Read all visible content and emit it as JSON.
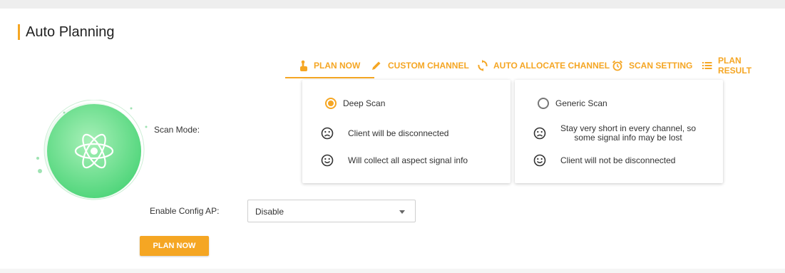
{
  "page": {
    "title": "Auto Planning",
    "accent_color": "#f5a623"
  },
  "tabs": [
    {
      "label": "PLAN NOW",
      "icon": "hand-pointer-icon",
      "active": true
    },
    {
      "label": "CUSTOM CHANNEL",
      "icon": "pencil-icon",
      "active": false
    },
    {
      "label": "AUTO ALLOCATE CHANNEL",
      "icon": "sync-icon",
      "active": false
    },
    {
      "label": "SCAN SETTING",
      "icon": "alarm-clock-icon",
      "active": false
    },
    {
      "label": "PLAN RESULT",
      "icon": "list-icon",
      "active": false
    }
  ],
  "scan_mode": {
    "label": "Scan Mode:",
    "options": [
      {
        "label": "Deep Scan",
        "selected": true,
        "items": [
          {
            "icon": "sad-face-icon",
            "text": "Client will be disconnected"
          },
          {
            "icon": "happy-face-icon",
            "text": "Will collect all aspect signal info"
          }
        ]
      },
      {
        "label": "Generic Scan",
        "selected": false,
        "items": [
          {
            "icon": "sad-face-icon",
            "text_line1": "Stay very short in every channel, so",
            "text_line2": "some signal info may be lost"
          },
          {
            "icon": "happy-face-icon",
            "text": "Client will not be disconnected"
          }
        ]
      }
    ]
  },
  "config_ap": {
    "label": "Enable Config AP:",
    "value": "Disable"
  },
  "action": {
    "button_label": "PLAN NOW"
  }
}
